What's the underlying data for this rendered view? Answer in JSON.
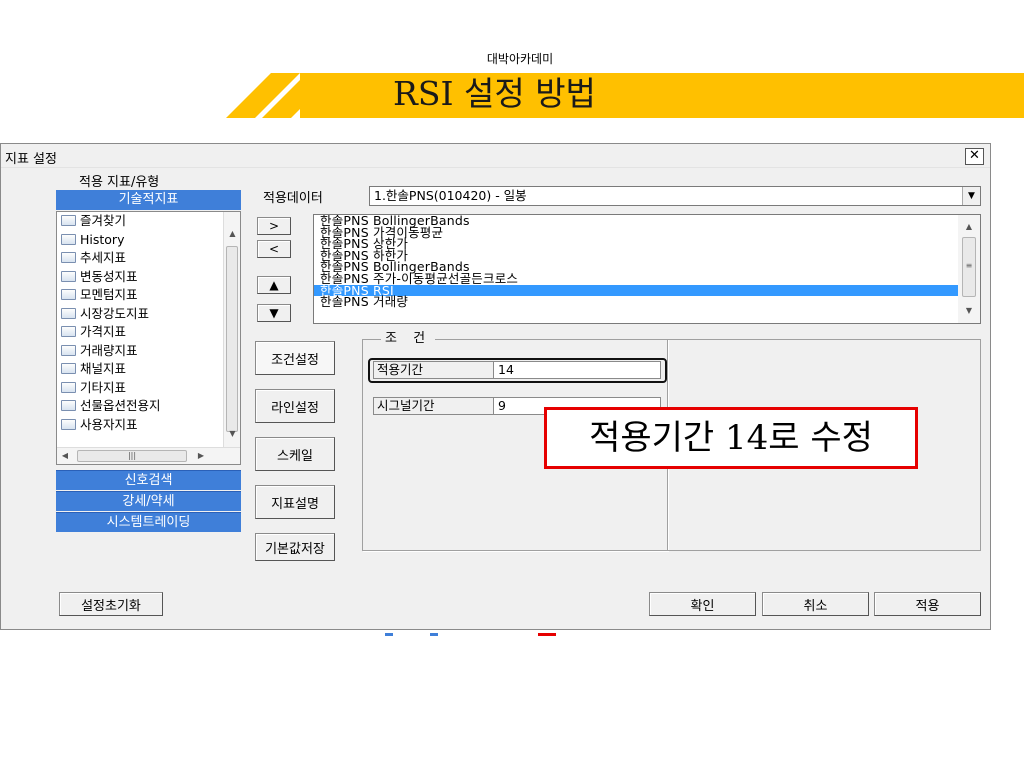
{
  "slide": {
    "subtitle": "대박아카데미",
    "title": "RSI 설정 방법"
  },
  "dialog": {
    "title": "지표 설정",
    "close_glyph": "✕",
    "left_label": "적용 지표/유형",
    "category_header": "기술적지표",
    "tree_items": [
      "즐겨찾기",
      "History",
      "추세지표",
      "변동성지표",
      "모멘텀지표",
      "시장강도지표",
      "가격지표",
      "거래량지표",
      "채널지표",
      "기타지표",
      "선물옵션전용지",
      "사용자지표"
    ],
    "bottom_tabs": [
      "신호검색",
      "강세/약세",
      "시스템트레이딩"
    ],
    "data_label": "적용데이터",
    "data_value": "1.한솔PNS(010420) - 일봉",
    "move_buttons": [
      ">",
      "<",
      "▲",
      "▼"
    ],
    "indicator_list": [
      "한솔PNS BollingerBands",
      "한솔PNS 가격이동평균",
      "한솔PNS 상한가",
      "한솔PNS 하한가",
      "한솔PNS BollingerBands",
      "한솔PNS 주가-이동평균선골든크로스",
      "한솔PNS RSI",
      "한솔PNS 거래량"
    ],
    "selected_indicator_index": 6,
    "side_buttons": [
      "조건설정",
      "라인설정",
      "스케일",
      "지표설명",
      "기본값저장"
    ],
    "group_title": "조 건",
    "fields": [
      {
        "label": "적용기간",
        "value": "14"
      },
      {
        "label": "시그널기간",
        "value": "9"
      }
    ],
    "callout": "적용기간 14로 수정",
    "reset_button": "설정초기화",
    "confirm_button": "확인",
    "cancel_button": "취소",
    "apply_button": "적용",
    "accent_color": "#3f7fd9",
    "selection_color": "#3399ff",
    "callout_border_color": "#e60000",
    "banner_color": "#ffc000"
  }
}
